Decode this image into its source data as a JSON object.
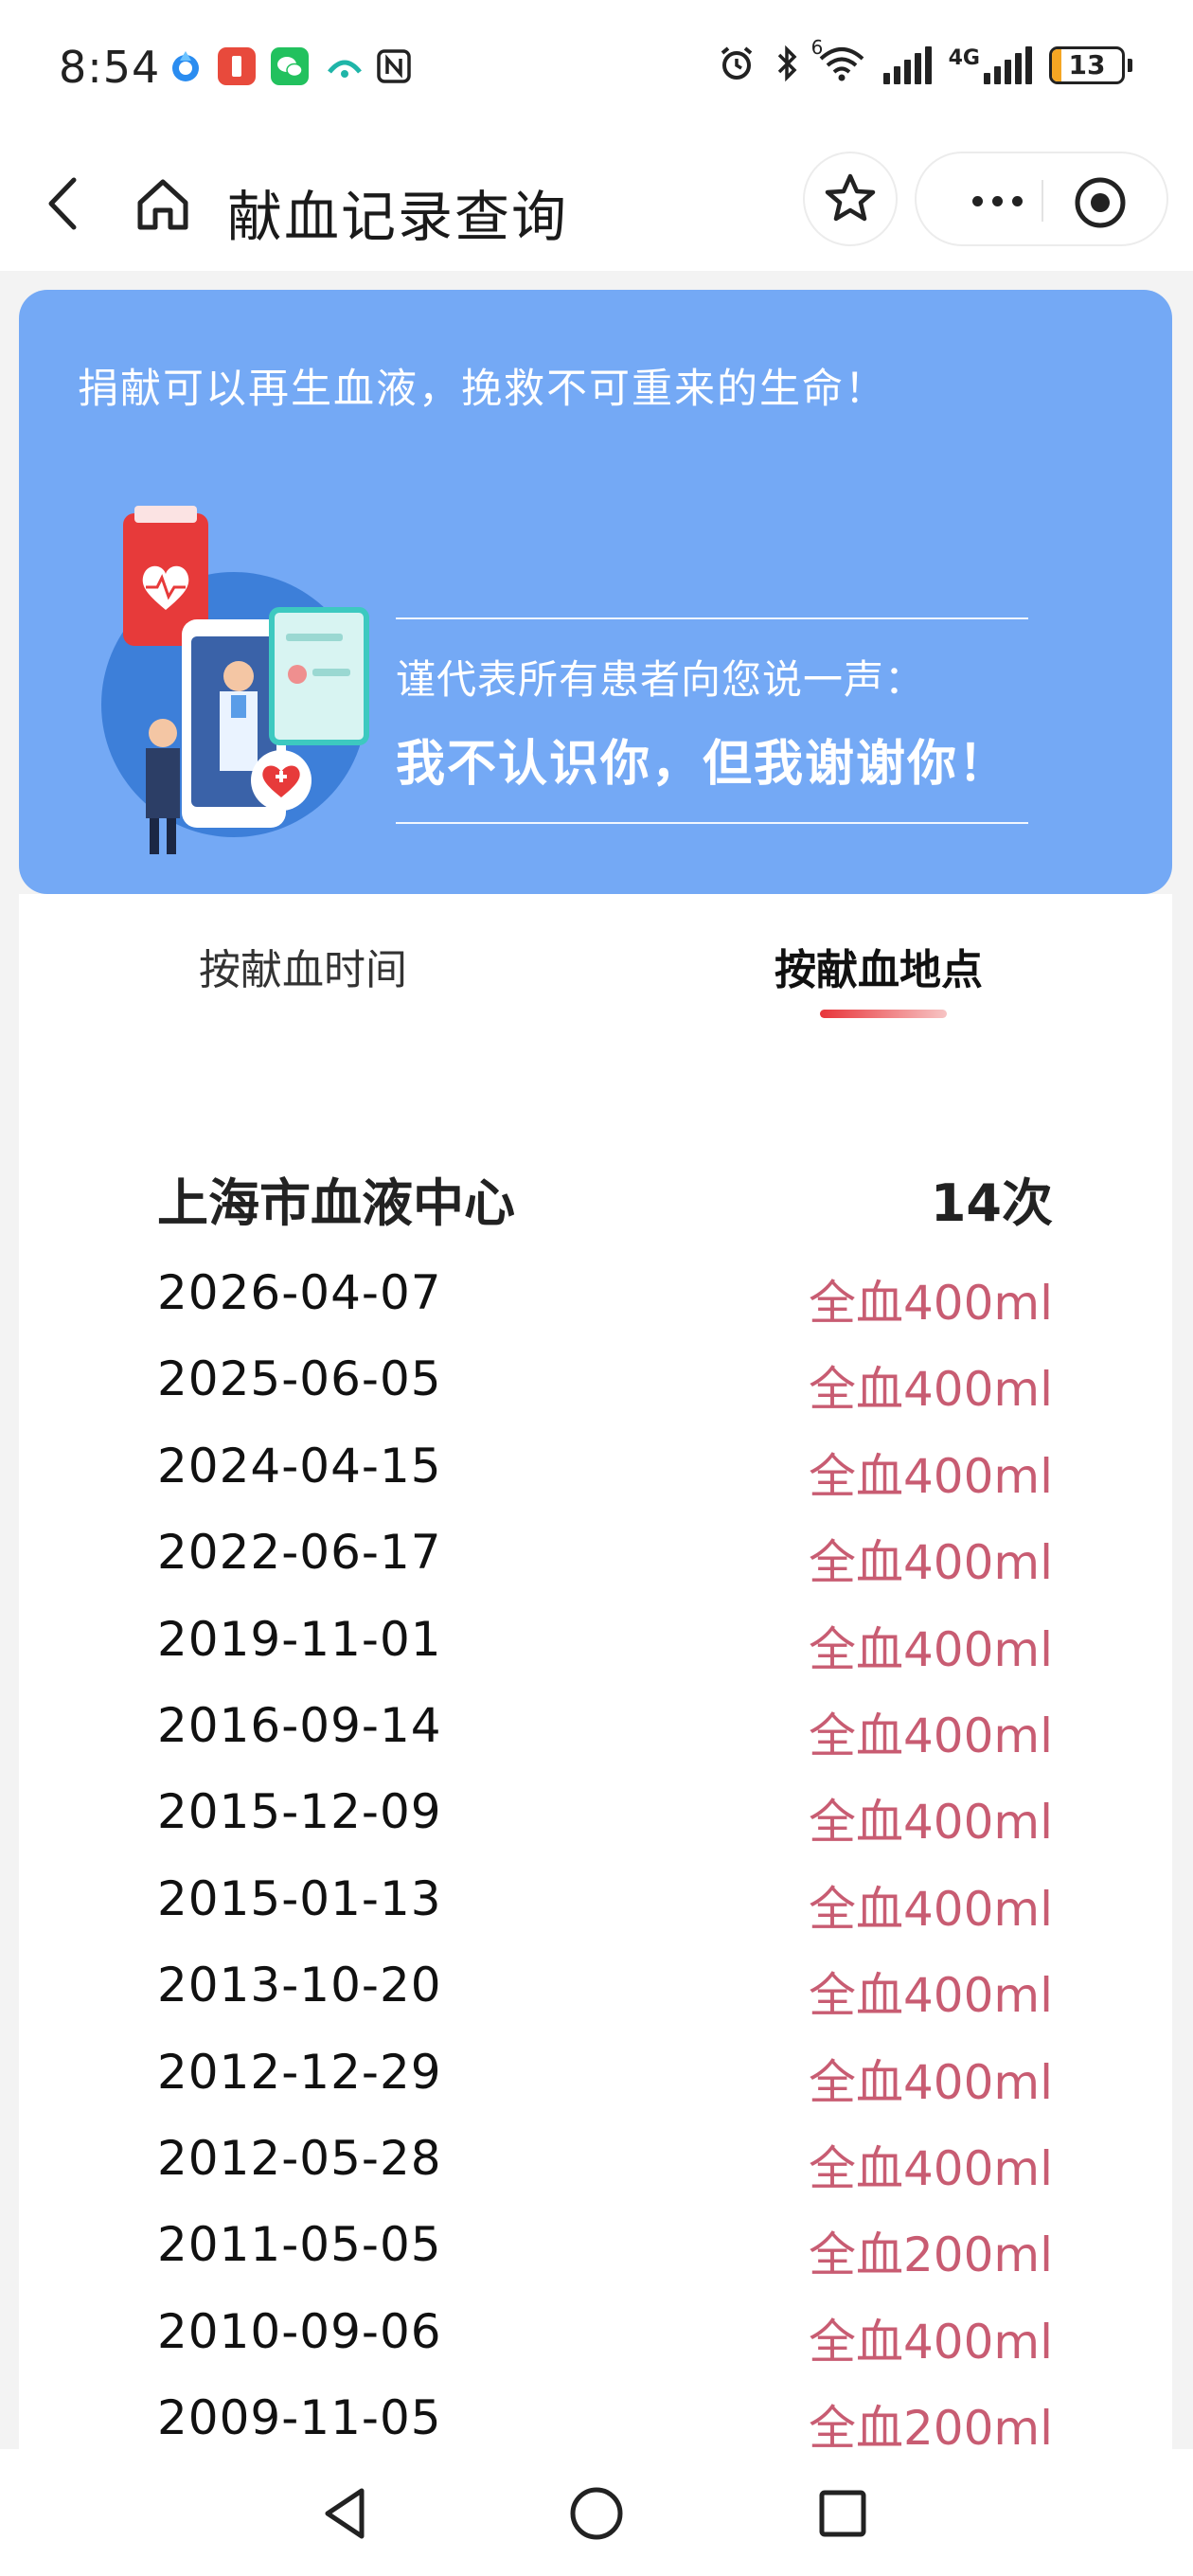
{
  "status_bar": {
    "time": "8:54",
    "battery_level": "13",
    "battery_fraction": 0.13,
    "icons": [
      "baidu-app-icon",
      "red-app-icon",
      "wechat-icon",
      "avatar-app-icon",
      "nfc-icon",
      "alarm-icon",
      "bluetooth-icon",
      "wifi-icon",
      "signal-icon",
      "4g-signal-icon"
    ],
    "network_label": "4G",
    "wifi_label": "6"
  },
  "nav": {
    "title": "献血记录查询"
  },
  "banner": {
    "slogan": "捐献可以再生血液，挽救不可重来的生命！",
    "subtitle": "谨代表所有患者向您说一声：",
    "headline": "我不认识你，但我谢谢你！",
    "bg_color": "#74a9f5"
  },
  "tabs": [
    {
      "label": "按献血时间",
      "active": false
    },
    {
      "label": "按献血地点",
      "active": true
    }
  ],
  "group": {
    "name": "上海市血液中心",
    "count": "14次",
    "records": [
      {
        "date": "2026-04-07",
        "volume": "全血400ml"
      },
      {
        "date": "2025-06-05",
        "volume": "全血400ml"
      },
      {
        "date": "2024-04-15",
        "volume": "全血400ml"
      },
      {
        "date": "2022-06-17",
        "volume": "全血400ml"
      },
      {
        "date": "2019-11-01",
        "volume": "全血400ml"
      },
      {
        "date": "2016-09-14",
        "volume": "全血400ml"
      },
      {
        "date": "2015-12-09",
        "volume": "全血400ml"
      },
      {
        "date": "2015-01-13",
        "volume": "全血400ml"
      },
      {
        "date": "2013-10-20",
        "volume": "全血400ml"
      },
      {
        "date": "2012-12-29",
        "volume": "全血400ml"
      },
      {
        "date": "2012-05-28",
        "volume": "全血400ml"
      },
      {
        "date": "2011-05-05",
        "volume": "全血200ml"
      },
      {
        "date": "2010-09-06",
        "volume": "全血400ml"
      },
      {
        "date": "2009-11-05",
        "volume": "全血200ml"
      }
    ]
  },
  "colors": {
    "accent": "#e8353a",
    "volume_text": "#c85c72"
  }
}
